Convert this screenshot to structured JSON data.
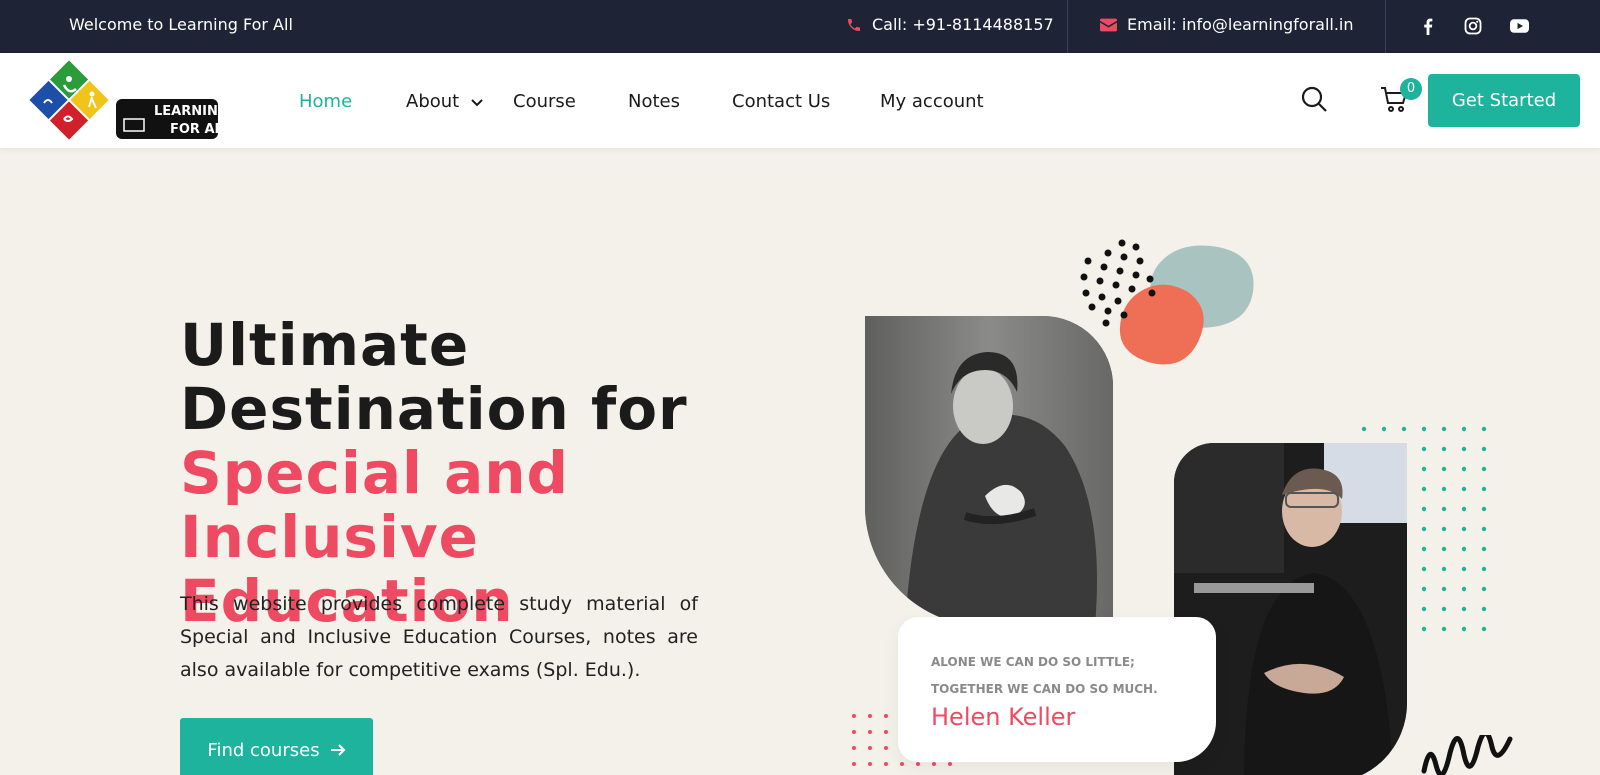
{
  "topbar": {
    "welcome": "Welcome to Learning For All",
    "call": "Call: +91-8114488157",
    "email": "Email: info@learningforall.in",
    "social_icons": [
      "facebook-icon",
      "instagram-icon",
      "youtube-icon"
    ]
  },
  "header": {
    "logo_text_line1": "LEARNING",
    "logo_text_line2": "FOR ALL",
    "nav": {
      "home": "Home",
      "about": "About",
      "course": "Course",
      "notes": "Notes",
      "contact": "Contact Us",
      "account": "My account"
    },
    "cart_count": "0",
    "get_started": "Get Started"
  },
  "hero": {
    "title_line1": "Ultimate",
    "title_line2": "Destination for",
    "title_line3": "Special and",
    "title_line4": "Inclusive Education",
    "description": "This website provides complete study material of Special and Inclusive Education Courses, notes are also available for competitive exams (Spl. Edu.).",
    "button": "Find courses"
  },
  "quote": {
    "line1": "ALONE WE CAN DO SO LITTLE;",
    "line2": "TOGETHER WE CAN DO SO MUCH.",
    "author": "Helen Keller"
  },
  "colors": {
    "accent_teal": "#1db39c",
    "accent_pink": "#ee4a62",
    "topbar_bg": "#1e2435",
    "page_bg": "#f4f1ea"
  }
}
